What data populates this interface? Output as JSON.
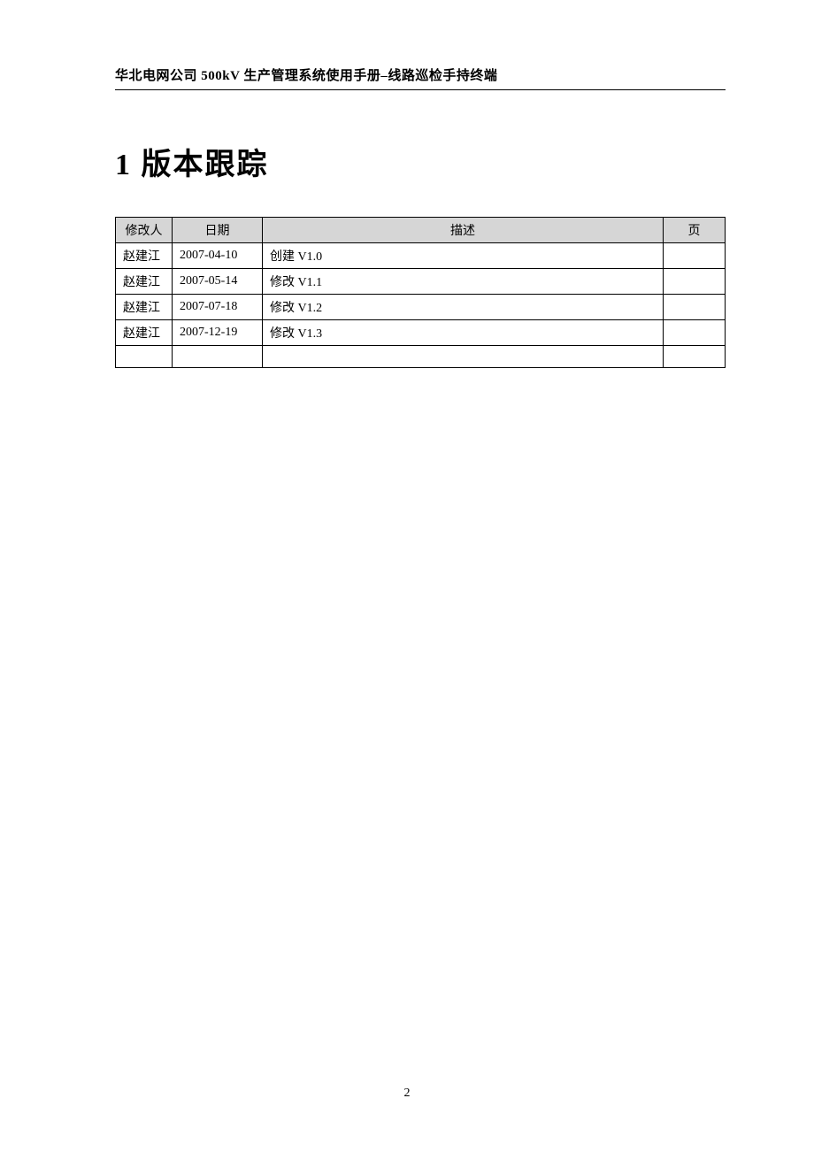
{
  "header": {
    "text": "华北电网公司 500kV 生产管理系统使用手册–线路巡检手持终端"
  },
  "section": {
    "title": "1 版本跟踪"
  },
  "table": {
    "headers": {
      "author": "修改人",
      "date": "日期",
      "desc": "描述",
      "page": "页"
    },
    "rows": [
      {
        "author": "赵建江",
        "date": "2007-04-10",
        "desc": "创建 V1.0",
        "page": ""
      },
      {
        "author": "赵建江",
        "date": "2007-05-14",
        "desc": "修改 V1.1",
        "page": ""
      },
      {
        "author": "赵建江",
        "date": "2007-07-18",
        "desc": "修改 V1.2",
        "page": ""
      },
      {
        "author": "赵建江",
        "date": "2007-12-19",
        "desc": "修改 V1.3",
        "page": ""
      },
      {
        "author": "",
        "date": "",
        "desc": "",
        "page": ""
      }
    ]
  },
  "footer": {
    "page_number": "2"
  }
}
